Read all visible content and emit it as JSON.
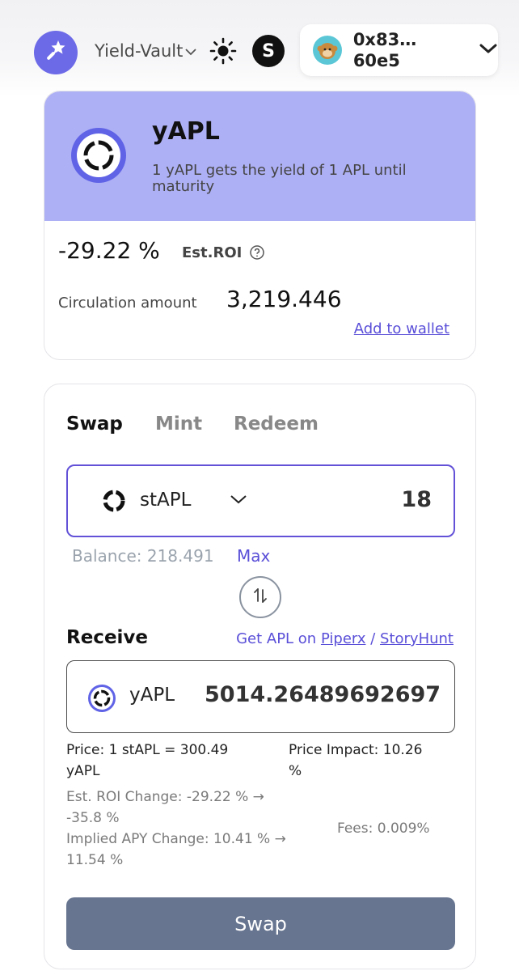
{
  "header": {
    "vault_name": "Yield-Vault",
    "s_badge": "S",
    "wallet_address_line1": "0x83…",
    "wallet_address_line2": "60e5"
  },
  "token_card": {
    "name": "yAPL",
    "description": "1 yAPL gets the yield of 1 APL until maturity",
    "roi_value": "-29.22 %",
    "roi_label": "Est.ROI",
    "circulation_label": "Circulation amount",
    "circulation_value": "3,219.446",
    "add_to_wallet": "Add to wallet"
  },
  "swap": {
    "tabs": [
      {
        "label": "Swap",
        "active": true
      },
      {
        "label": "Mint",
        "active": false
      },
      {
        "label": "Redeem",
        "active": false
      }
    ],
    "input": {
      "token": "stAPL",
      "amount": "18"
    },
    "balance_label": "Balance: 218.491",
    "max_label": "Max",
    "receive_label": "Receive",
    "get_apl_prefix": "Get APL on",
    "link_piperx": "Piperx",
    "link_separator": "/",
    "link_storyhunt": "StoryHunt",
    "output": {
      "token": "yAPL",
      "amount": "5014.26489692697"
    },
    "price_line1": "Price: 1 stAPL = 300.49",
    "price_line2": "yAPL",
    "impact_line1": "Price Impact: 10.26",
    "impact_line2": "%",
    "roi_change_line1": "Est. ROI Change: -29.22 % →",
    "roi_change_line2": "-35.8 %",
    "apy_change_line1": "Implied APY Change: 10.41 % →",
    "apy_change_line2": "11.54 %",
    "fees": "Fees:  0.009%",
    "swap_button": "Swap"
  },
  "colors": {
    "accent": "#5a4fd8",
    "banner": "#aeb0f5",
    "swap_button": "#677590"
  }
}
